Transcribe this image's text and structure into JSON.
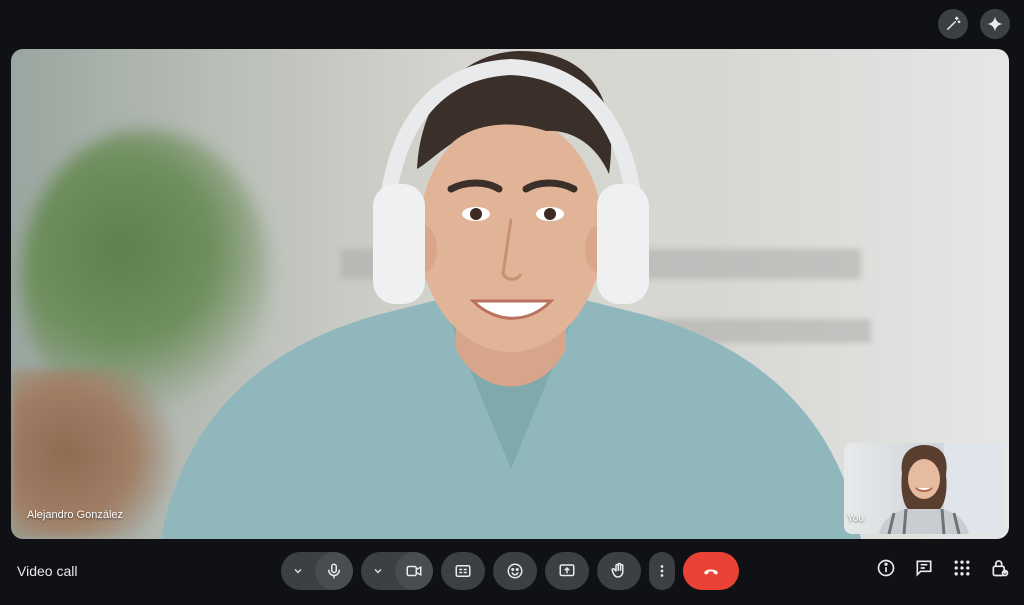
{
  "meeting": {
    "title": "Video call"
  },
  "participants": {
    "main": {
      "name": "Alejandro González"
    },
    "self": {
      "label": "You"
    }
  },
  "icons": {
    "top": [
      "magic-wand-icon",
      "sparkle-icon"
    ],
    "controls": [
      "chevron-down-icon",
      "mic-icon",
      "chevron-down-icon",
      "camera-icon",
      "captions-icon",
      "emoji-icon",
      "present-icon",
      "raise-hand-icon",
      "more-vert-icon",
      "hang-up-icon"
    ],
    "right": [
      "info-icon",
      "chat-icon",
      "apps-icon",
      "lock-person-icon"
    ]
  },
  "colors": {
    "end_call": "#ea4335",
    "button": "#3c4043",
    "background": "#101114"
  }
}
